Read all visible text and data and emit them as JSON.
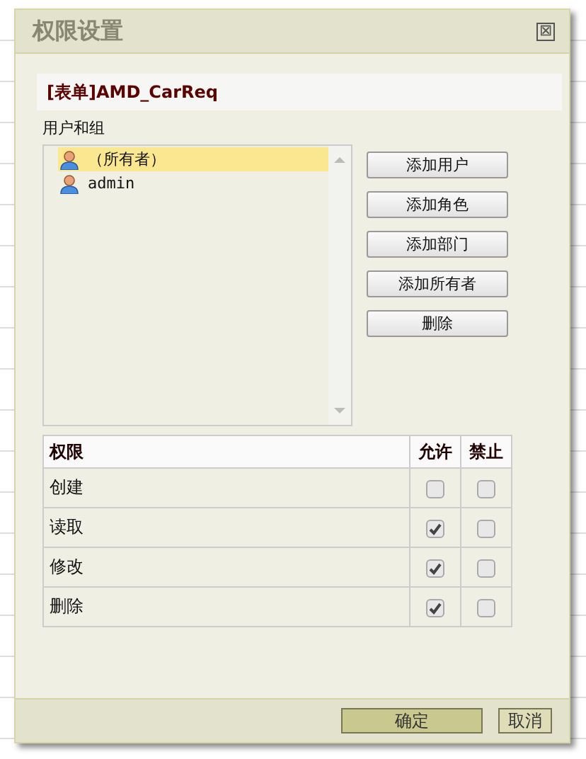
{
  "window": {
    "title": "权限设置",
    "close": "⊠"
  },
  "form_name": "[表单]AMD_CarReq",
  "users_label": "用户和组",
  "users": [
    {
      "name": "（所有者）",
      "selected": true
    },
    {
      "name": "admin",
      "selected": false
    }
  ],
  "buttons": [
    "添加用户",
    "添加角色",
    "添加部门",
    "添加所有者",
    "删除"
  ],
  "table": {
    "columns": [
      "权限",
      "允许",
      "禁止"
    ],
    "rows": [
      {
        "name": "创建",
        "allow": false,
        "deny": false
      },
      {
        "name": "读取",
        "allow": true,
        "deny": false
      },
      {
        "name": "修改",
        "allow": true,
        "deny": false
      },
      {
        "name": "删除",
        "allow": true,
        "deny": false
      }
    ]
  },
  "footer": {
    "ok": "确定",
    "cancel": "取消"
  }
}
